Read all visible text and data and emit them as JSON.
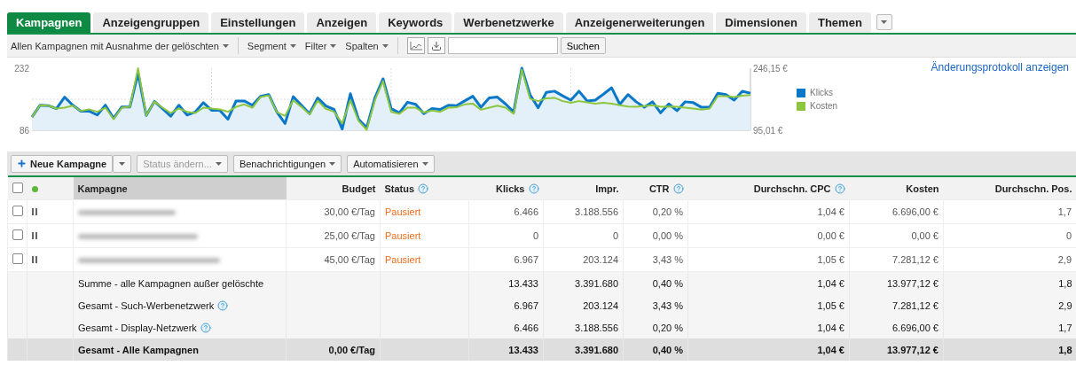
{
  "tabs": [
    {
      "label": "Kampagnen",
      "selected": true
    },
    {
      "label": "Anzeigengruppen",
      "selected": false
    },
    {
      "label": "Einstellungen",
      "selected": false
    },
    {
      "label": "Anzeigen",
      "selected": false
    },
    {
      "label": "Keywords",
      "selected": false
    },
    {
      "label": "Werbenetzwerke",
      "selected": false
    },
    {
      "label": "Anzeigenerweiterungen",
      "selected": false
    },
    {
      "label": "Dimensionen",
      "selected": false
    },
    {
      "label": "Themen",
      "selected": false
    }
  ],
  "toolbar": {
    "view_filter": "Allen Kampagnen mit Ausnahme der gelöschten",
    "menus": [
      "Segment",
      "Filter",
      "Spalten"
    ],
    "search_button": "Suchen"
  },
  "chart_panel": {
    "link": "Änderungsprotokoll anzeigen",
    "chart_data": {
      "type": "line",
      "grid": true,
      "ylim": [
        86,
        232
      ],
      "yticks": [
        86,
        232
      ],
      "y2lim": [
        95.01,
        246.15
      ],
      "y2ticks": [
        {
          "value": 95.01,
          "label": "95,01 €"
        },
        {
          "value": 246.15,
          "label": "246,15 €"
        }
      ],
      "series": [
        {
          "name": "Klicks",
          "color": "#0a78c8",
          "values": [
            117,
            145,
            144,
            137,
            164,
            145,
            131,
            131,
            122,
            145,
            114,
            141,
            141,
            220,
            121,
            154,
            137,
            119,
            145,
            122,
            129,
            151,
            133,
            133,
            112,
            155,
            155,
            145,
            166,
            170,
            129,
            102,
            165,
            145,
            125,
            162,
            143,
            135,
            89,
            172,
            112,
            92,
            162,
            207,
            137,
            127,
            152,
            147,
            125,
            137,
            135,
            145,
            144,
            155,
            166,
            140,
            162,
            164,
            148,
            129,
            232,
            170,
            139,
            175,
            178,
            167,
            157,
            178,
            155,
            157,
            171,
            186,
            147,
            170,
            153,
            140,
            153,
            127,
            148,
            132,
            153,
            151,
            140,
            140,
            173,
            170,
            157,
            178,
            173
          ]
        },
        {
          "name": "Kosten",
          "color": "#8cc63f",
          "axis": "y2",
          "values": [
            127,
            156,
            155,
            148,
            150,
            155,
            142,
            146,
            140,
            150,
            122,
            150,
            152,
            246,
            131,
            165,
            150,
            137,
            148,
            140,
            137,
            150,
            148,
            146,
            140,
            152,
            158,
            150,
            176,
            180,
            139,
            130,
            168,
            152,
            134,
            167,
            147,
            140,
            112,
            168,
            118,
            96,
            168,
            215,
            140,
            135,
            150,
            150,
            138,
            143,
            140,
            150,
            151,
            158,
            160,
            145,
            150,
            155,
            150,
            135,
            243,
            172,
            166,
            173,
            174,
            166,
            162,
            166,
            163,
            160,
            162,
            160,
            156,
            153,
            152,
            154,
            156,
            152,
            153,
            152,
            150,
            148,
            145,
            148,
            178,
            178,
            176,
            179,
            181
          ]
        }
      ]
    }
  },
  "actions": [
    {
      "label": "Neue Kampagne",
      "kind": "split",
      "disabled": false
    },
    {
      "label": "Status ändern...",
      "kind": "dropdown",
      "disabled": true
    },
    {
      "label": "Benachrichtigungen",
      "kind": "dropdown",
      "disabled": false
    },
    {
      "label": "Automatisieren",
      "kind": "dropdown",
      "disabled": false
    }
  ],
  "table": {
    "header_checked": false,
    "columns": [
      {
        "label": "Kampagne",
        "help": false,
        "sorted": true
      },
      {
        "label": "Budget",
        "help": false,
        "sorted": false
      },
      {
        "label": "Status",
        "help": true,
        "sorted": false
      },
      {
        "label": "Klicks",
        "help": true,
        "sorted": false
      },
      {
        "label": "Impr.",
        "help": false,
        "sorted": false
      },
      {
        "label": "CTR",
        "help": true,
        "sorted": false
      },
      {
        "label": "Durchschn. CPC",
        "help": true,
        "sorted": false
      },
      {
        "label": "Kosten",
        "help": false,
        "sorted": false
      },
      {
        "label": "Durchschn. Pos.",
        "help": false,
        "sorted": false
      }
    ],
    "rows": [
      {
        "checked": false,
        "budget": "30,00 €/Tag",
        "status": "Pausiert",
        "values": [
          "6.466",
          "3.188.556",
          "0,20 %",
          "1,04 €",
          "6.696,00 €",
          "1,7"
        ]
      },
      {
        "checked": false,
        "budget": "25,00 €/Tag",
        "status": "Pausiert",
        "values": [
          "0",
          "0",
          "0,00 %",
          "0,00 €",
          "0,00 €",
          "0"
        ]
      },
      {
        "checked": false,
        "budget": "45,00 €/Tag",
        "status": "Pausiert",
        "values": [
          "6.967",
          "203.124",
          "3,43 %",
          "1,05 €",
          "7.281,12 €",
          "2,9"
        ]
      }
    ],
    "summary_rows": [
      {
        "kind": "subtotal",
        "label": "Summe - alle Kampagnen außer gelöschte",
        "help": false,
        "values": [
          "13.433",
          "3.391.680",
          "0,40 %",
          "1,04 €",
          "13.977,12 €",
          "1,8"
        ]
      },
      {
        "kind": "subtotal",
        "label": "Gesamt - Such-Werbenetzwerk",
        "help": true,
        "values": [
          "6.967",
          "203.124",
          "3,43 %",
          "1,05 €",
          "7.281,12 €",
          "2,9"
        ]
      },
      {
        "kind": "subtotal",
        "label": "Gesamt - Display-Netzwerk",
        "help": true,
        "values": [
          "6.466",
          "3.188.556",
          "0,20 %",
          "1,04 €",
          "6.696,00 €",
          "1,7"
        ]
      },
      {
        "kind": "total",
        "label": "Gesamt - Alle Kampagnen",
        "help": false,
        "budget": "0,00 €/Tag",
        "values": [
          "13.433",
          "3.391.680",
          "0,40 %",
          "1,04 €",
          "13.977,12 €",
          "1,8"
        ]
      }
    ]
  }
}
